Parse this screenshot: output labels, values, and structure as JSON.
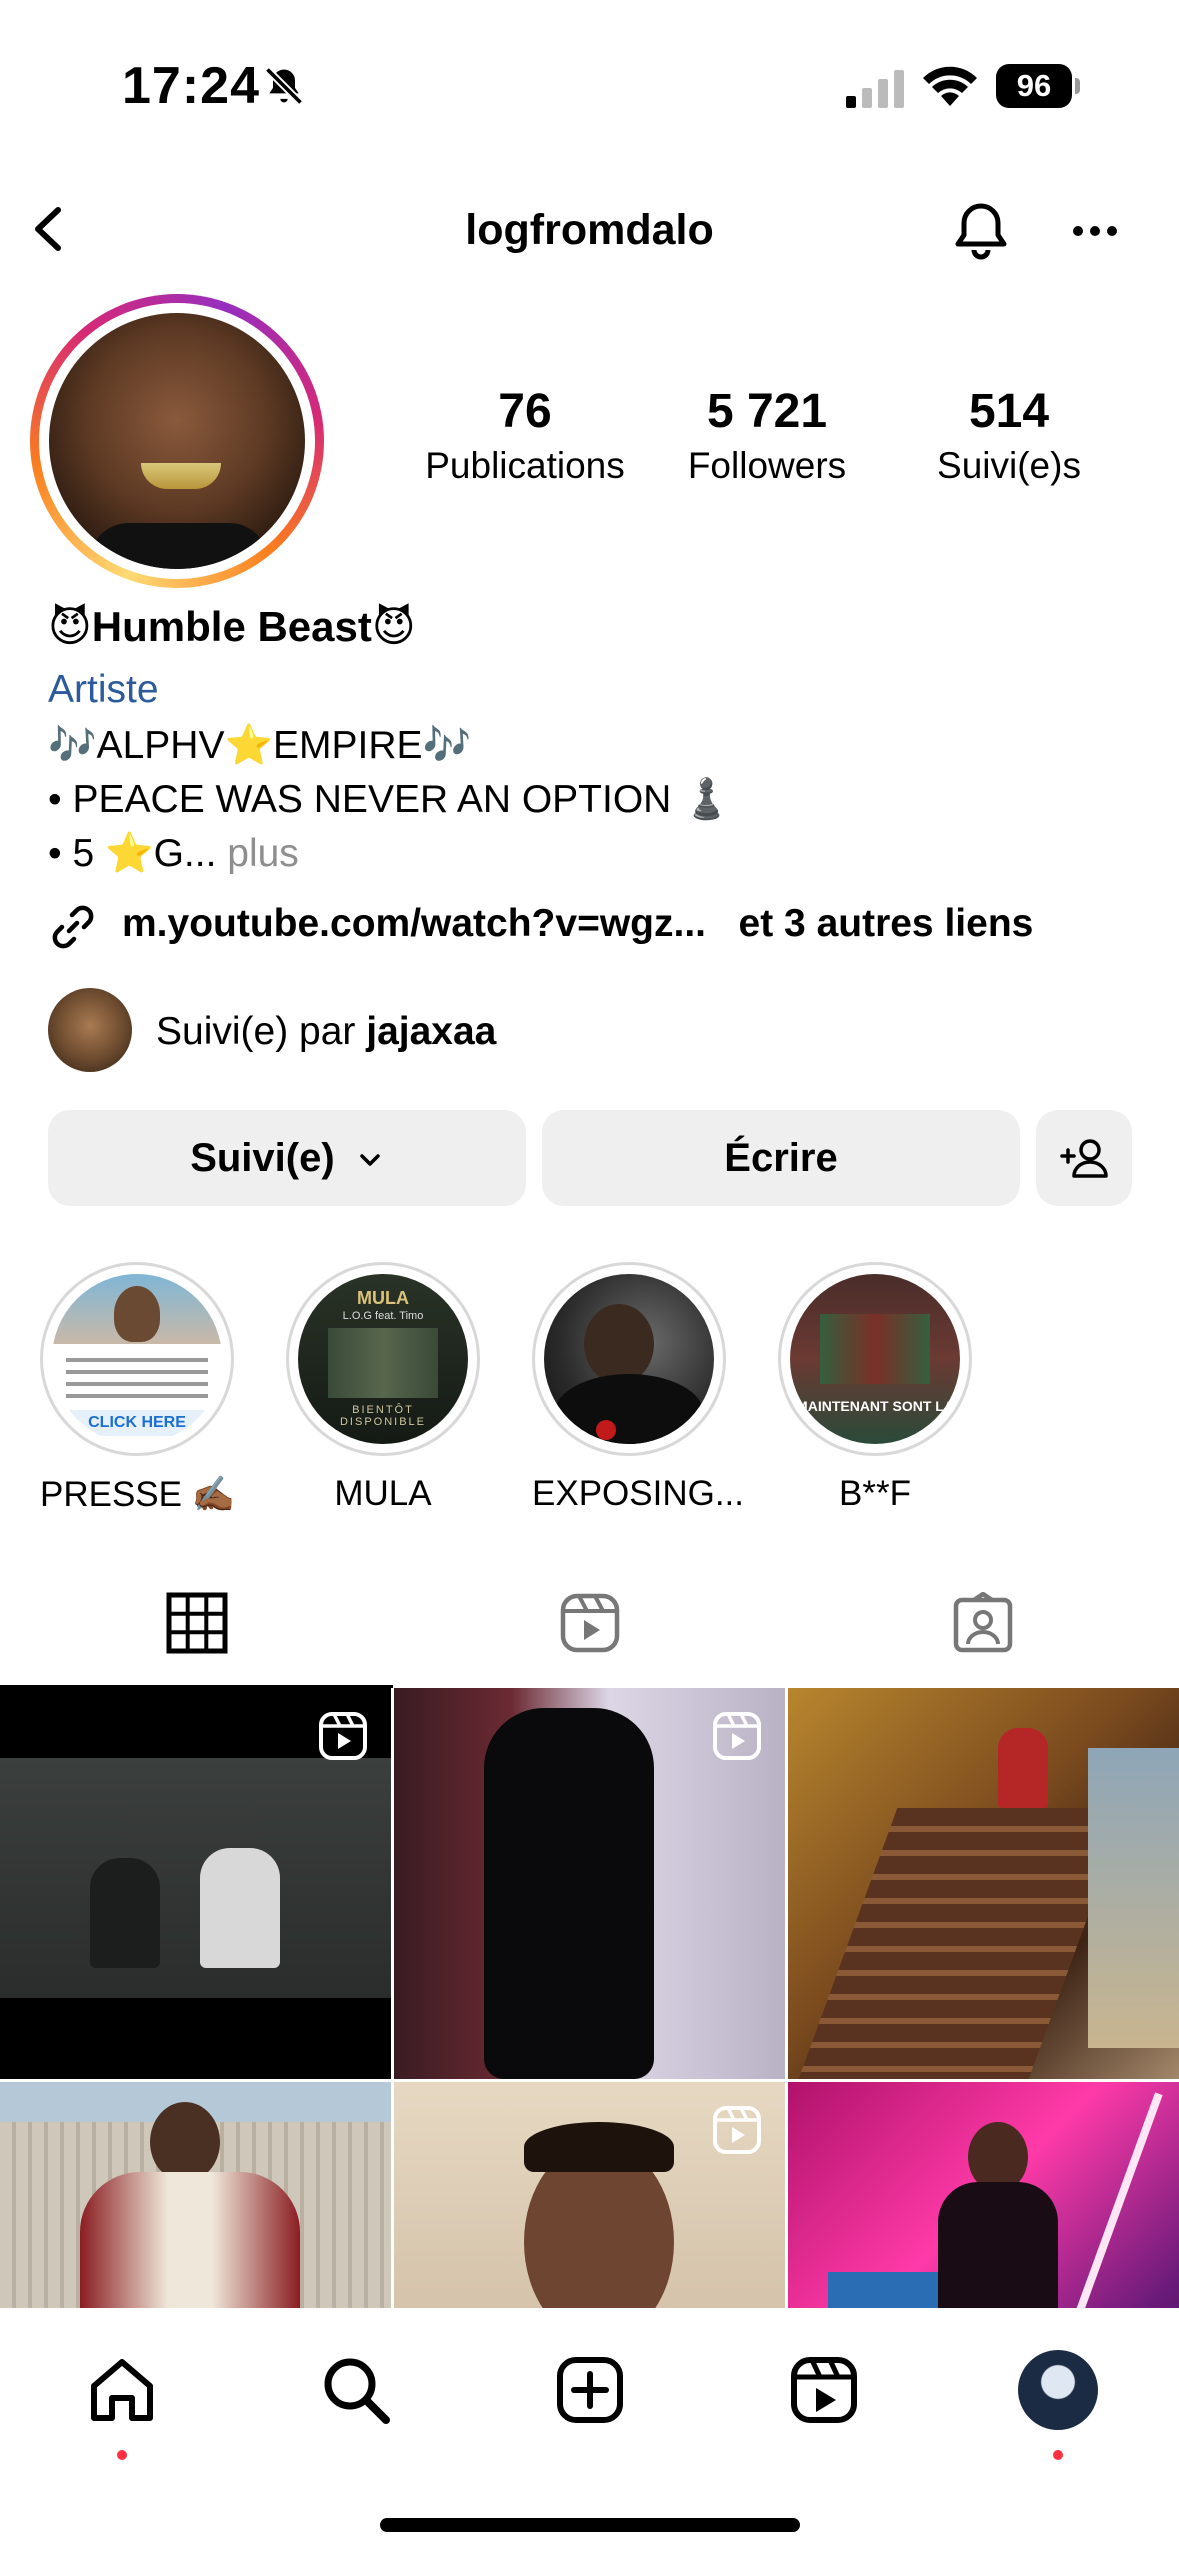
{
  "status_bar": {
    "time": "17:24",
    "battery": "96"
  },
  "header": {
    "username": "logfromdalo"
  },
  "stats": [
    {
      "value": "76",
      "label": "Publications"
    },
    {
      "value": "5 721",
      "label": "Followers"
    },
    {
      "value": "514",
      "label": "Suivi(e)s"
    }
  ],
  "profile": {
    "display_name": "😈Humble Beast😈",
    "category": "Artiste",
    "bio_lines": [
      "🎶ALPHV⭐EMPIRE🎶",
      "• PEACE WAS NEVER AN OPTION ♟️",
      "• 5 ⭐G..."
    ],
    "bio_more": "plus",
    "link": "m.youtube.com/watch?v=wgz...",
    "link_more": "et 3 autres liens"
  },
  "followed_by": {
    "prefix": "Suivi(e) par",
    "user": "jajaxaa"
  },
  "actions": {
    "follow_label": "Suivi(e)",
    "message_label": "Écrire"
  },
  "highlights": [
    {
      "label": "PRESSE ✍🏾"
    },
    {
      "label": "MULA"
    },
    {
      "label": "EXPOSING..."
    },
    {
      "label": "B**F"
    }
  ],
  "highlight_texts": {
    "h1": "CLICK HERE",
    "h2_top": "MULA",
    "h2_sub": "L.O.G feat. Timo",
    "h2_bottom": "BIENTÔT DISPONIBLE",
    "h4": "MAINTENANT SONT LA"
  },
  "colors": {
    "accent_link": "#2d5a9b",
    "button_bg": "#efefef",
    "badge": "#ff3040"
  },
  "icons": [
    "back-icon",
    "bell-icon",
    "more-icon",
    "grid-icon",
    "reels-icon",
    "tagged-icon",
    "home-icon",
    "search-icon",
    "create-icon",
    "reels-icon",
    "profile-avatar"
  ]
}
